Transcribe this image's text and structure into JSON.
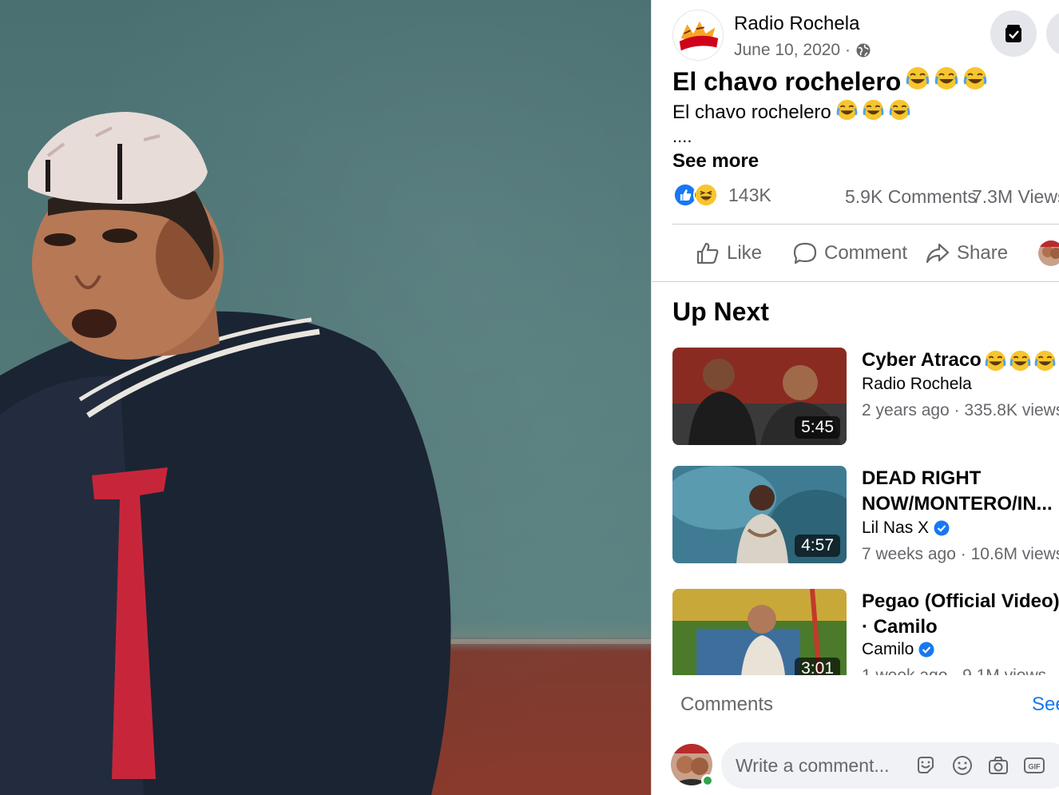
{
  "post": {
    "page_name": "Radio Rochela",
    "date": "June 10, 2020 ·",
    "title": "El chavo rochelero",
    "text": "El chavo rochelero",
    "ellipsis": "....",
    "see_more": "See more",
    "reaction_count": "143K",
    "comments_count": "5.9K Comments",
    "views_count": "7.3M Views"
  },
  "actions": {
    "like": "Like",
    "comment": "Comment",
    "share": "Share"
  },
  "up_next": {
    "heading": "Up Next",
    "videos": [
      {
        "title": "Cyber Atraco",
        "channel": "Radio Rochela",
        "age": "2 years ago",
        "views": "335.8K views",
        "duration": "5:45",
        "verified": false
      },
      {
        "title": "DEAD RIGHT NOW/MONTERO/IN...",
        "channel": "Lil Nas X",
        "age": "7 weeks ago",
        "views": "10.6M views",
        "duration": "4:57",
        "verified": true
      },
      {
        "title": "Pegao (Official Video) · Camilo",
        "channel": "Camilo",
        "age": "1 week ago",
        "views": "9.1M views",
        "duration": "3:01",
        "verified": true
      }
    ]
  },
  "comments": {
    "label": "Comments",
    "see_all": "See all",
    "placeholder": "Write a comment..."
  },
  "icons": {
    "globe": "globe-icon",
    "save": "save-bookmark-icon",
    "like": "thumbs-up-icon",
    "comment": "speech-bubble-icon",
    "share": "share-arrow-icon",
    "emoji": "laughing-emoji-icon",
    "verified": "verified-badge-icon",
    "sticker": "sticker-icon",
    "smiley": "smiley-icon",
    "camera": "camera-icon",
    "gif": "gif-icon"
  },
  "colors": {
    "accent": "#1877f2",
    "secondary_text": "#65676b",
    "online": "#31a24c"
  }
}
